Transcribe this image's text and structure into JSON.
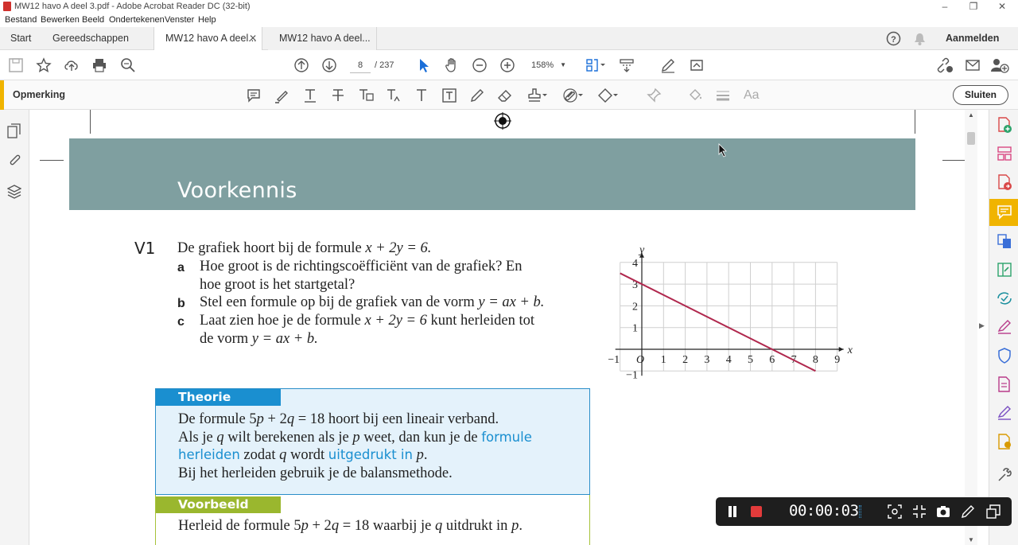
{
  "window": {
    "title": "MW12 havo A deel 3.pdf - Adobe Acrobat Reader DC (32-bit)",
    "controls": [
      "minimize",
      "maximize",
      "close"
    ]
  },
  "menu": [
    "Bestand",
    "Bewerken",
    "Beeld",
    "Ondertekenen",
    "Venster",
    "Help"
  ],
  "tabs": {
    "home": "Start",
    "tools": "Gereedschappen",
    "docs": [
      {
        "label": "MW12 havo A deel...",
        "active": true
      },
      {
        "label": "MW12 havo A deel...",
        "active": false
      }
    ],
    "signin": "Aanmelden"
  },
  "toolbar": {
    "page_current": "8",
    "page_total": "/  237",
    "zoom": "158%"
  },
  "comment_bar": {
    "label": "Opmerking",
    "close_label": "Sluiten",
    "accent": "#f0b400"
  },
  "document": {
    "banner_title": "Voorkennis",
    "banner_color": "#7f9fa0",
    "question": {
      "number": "V1",
      "intro_a": "De grafiek hoort bij de formule ",
      "intro_formula": "x + 2y = 6.",
      "parts": [
        {
          "letter": "a",
          "line1": "Hoe groot is de richtingscoëfficiënt van de grafiek? En",
          "line2": "hoe groot is het startgetal?"
        },
        {
          "letter": "b",
          "line1a": "Stel een formule op bij de grafiek van de vorm ",
          "line1b": "y = ax + b."
        },
        {
          "letter": "c",
          "line1a": "Laat zien hoe je de formule ",
          "line1b": "x + 2y = 6",
          "line1c": " kunt herleiden tot",
          "line2a": "de vorm ",
          "line2b": "y = ax + b."
        }
      ]
    },
    "theorie": {
      "header": "Theorie",
      "l1a": "De formule 5",
      "l1b": "p",
      "l1c": " + 2",
      "l1d": "q",
      "l1e": " = 18 hoort bij een lineair verband.",
      "l2a": "Als je ",
      "l2b": "q",
      "l2c": " wilt berekenen als je ",
      "l2d": "p",
      "l2e": " weet, dan kun je de ",
      "l2f": "formule",
      "l3a": "herleiden",
      "l3b": " zodat ",
      "l3c": "q",
      "l3d": " wordt ",
      "l3e": "uitgedrukt in",
      "l3f": " ",
      "l3g": "p",
      "l3h": ".",
      "l4": "Bij het herleiden gebruik je de balansmethode.",
      "accent": "#1a8fd0"
    },
    "voorbeeld": {
      "header": "Voorbeeld",
      "l1a": "Herleid de formule 5",
      "l1b": "p",
      "l1c": " + 2",
      "l1d": "q",
      "l1e": " = 18 waarbij je ",
      "l1f": "q",
      "l1g": " uitdrukt in ",
      "l1h": "p",
      "l1i": ".",
      "accent": "#9ab72e"
    }
  },
  "chart_data": {
    "type": "line",
    "xlabel": "x",
    "ylabel": "y",
    "xlim": [
      -1,
      9
    ],
    "ylim": [
      -1,
      4
    ],
    "xticks": [
      "−1",
      "O",
      "1",
      "2",
      "3",
      "4",
      "5",
      "6",
      "7",
      "8",
      "9"
    ],
    "yticks": [
      "4",
      "3",
      "2",
      "1",
      "−1"
    ],
    "grid": true,
    "series": [
      {
        "x": [
          -1,
          8
        ],
        "y": [
          3.5,
          -1
        ],
        "color": "#b0284e"
      }
    ]
  },
  "recorder": {
    "time": "00:00:03"
  }
}
